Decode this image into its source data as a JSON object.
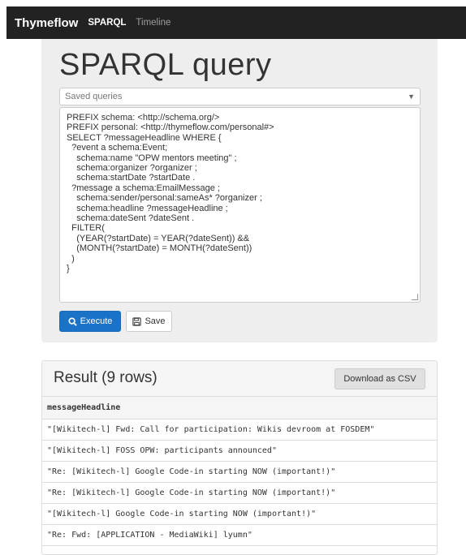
{
  "navbar": {
    "brand": "Thymeflow",
    "links": [
      "SPARQL",
      "Timeline"
    ]
  },
  "query_panel": {
    "title": "SPARQL query",
    "saved_queries_placeholder": "Saved queries",
    "query_lines": [
      "PREFIX schema: <http://schema.org/>",
      "PREFIX personal: <http://thymeflow.com/personal#>",
      "SELECT ?messageHeadline WHERE {",
      "  ?event a schema:Event;",
      "    schema:name \"OPW mentors meeting\" ;",
      "    schema:organizer ?organizer ;",
      "    schema:startDate ?startDate .",
      "  ?message a schema:EmailMessage ;",
      "    schema:sender/personal:sameAs* ?organizer ;",
      "    schema:headline ?messageHeadline ;",
      "    schema:dateSent ?dateSent .",
      "  FILTER(",
      "    (YEAR(?startDate) = YEAR(?dateSent)) &&",
      "    (MONTH(?startDate) = MONTH(?dateSent))",
      "  )",
      "}"
    ],
    "execute_label": "Execute",
    "save_label": "Save"
  },
  "results": {
    "title": "Result (9 rows)",
    "download_label": "Download as CSV",
    "column": "messageHeadline",
    "rows": [
      "\"[Wikitech-l] Fwd: Call for participation: Wikis devroom at FOSDEM\"",
      "\"[Wikitech-l] FOSS OPW: participants announced\"",
      "\"Re: [Wikitech-l] Google Code-in starting NOW (important!)\"",
      "\"Re: [Wikitech-l] Google Code-in starting NOW (important!)\"",
      "\"[Wikitech-l] Google Code-in starting NOW (important!)\"",
      "\"Re: Fwd: [APPLICATION - MediaWiki] lyumn\""
    ]
  },
  "colors": {
    "navbar_bg": "#222222",
    "primary": "#1a73c7",
    "jumbotron_bg": "#eeeeee"
  },
  "icons": {
    "execute": "search-icon",
    "save": "floppy-disk-icon",
    "select": "caret-down-icon"
  }
}
